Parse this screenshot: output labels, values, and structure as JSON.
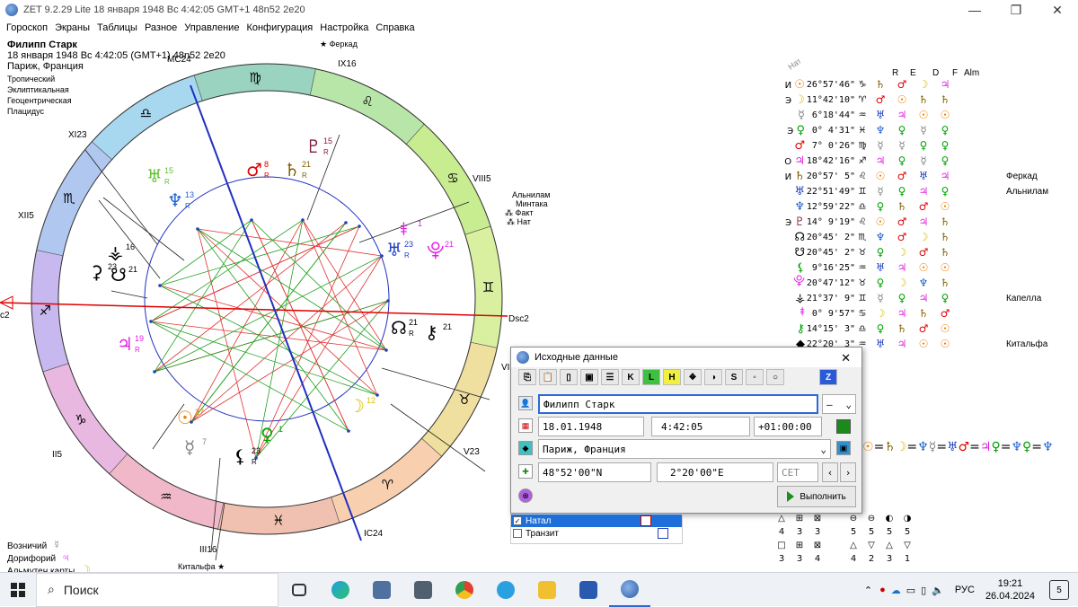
{
  "window": {
    "title": "ZET 9.2.29 Lite   18 января 1948  Вс   4:42:05 GMT+1 48n52  2e20",
    "minimize": "—",
    "maximize": "❐",
    "close": "✕"
  },
  "menu": [
    "Гороскоп",
    "Экраны",
    "Таблицы",
    "Разное",
    "Управление",
    "Конфигурация",
    "Настройка",
    "Справка"
  ],
  "info": {
    "name": "Филипп Старк",
    "datetime": "18 января 1948  Вс   4:42:05 (GMT+1) 48n52  2e20",
    "place": "Париж, Франция",
    "zodiac": "Тропический",
    "coords": "Эклиптикальная",
    "center": "Геоцентрическая",
    "houses": "Плацидус"
  },
  "rulers": [
    {
      "label": "Возничий",
      "glyph": "☿",
      "color": "#808080"
    },
    {
      "label": "Дорифорий",
      "glyph": "♃",
      "color": "#e020e0"
    },
    {
      "label": "Альмутен карты",
      "glyph": "☽",
      "color": "#d8c000"
    }
  ],
  "wheel": {
    "houses": {
      "asc": "c2",
      "dsc": "Dsc2",
      "mc": "MC24",
      "ic": "IC24",
      "h2": "II5",
      "h3": "III16",
      "h5": "V23",
      "h6": "VI5",
      "h8": "VIII5",
      "h9": "IX16",
      "h11": "XI23",
      "h12": "XII5"
    },
    "stars": {
      "ferkad": "Феркад",
      "alnilam": "Альнилам",
      "mintaka": "Минтака",
      "fakt": "Факт",
      "nat": "Нат",
      "kitalfa": "Китальфа"
    },
    "planets": [
      {
        "glyph": "☉",
        "deg": "27",
        "color": "#f08000"
      },
      {
        "glyph": "☽",
        "deg": "12",
        "color": "#d8c000"
      },
      {
        "glyph": "☿",
        "deg": "7",
        "color": "#808080"
      },
      {
        "glyph": "♀",
        "deg": "1",
        "color": "#00a000"
      },
      {
        "glyph": "♂",
        "deg": "8",
        "color": "#e00000"
      },
      {
        "glyph": "♃",
        "deg": "19",
        "color": "#e020e0"
      },
      {
        "glyph": "♄",
        "deg": "21",
        "color": "#806000"
      },
      {
        "glyph": "♅",
        "deg": "23",
        "color": "#2040c0"
      },
      {
        "glyph": "♆",
        "deg": "13",
        "color": "#2060d0"
      },
      {
        "glyph": "♇",
        "deg": "15",
        "color": "#802040"
      },
      {
        "glyph": "☊",
        "deg": "21",
        "color": "#000000"
      },
      {
        "glyph": "☋",
        "deg": "21",
        "color": "#000000"
      },
      {
        "glyph": "⚸",
        "deg": "23",
        "color": "#000000"
      },
      {
        "glyph": "⚷",
        "deg": "21",
        "color": "#000000"
      },
      {
        "glyph": "♅",
        "deg": "15",
        "color": "#60c030"
      },
      {
        "glyph": "⚶",
        "deg": "16",
        "color": "#000000"
      },
      {
        "glyph": "⚳",
        "deg": "23",
        "color": "#000000"
      },
      {
        "glyph": "⯓",
        "deg": "21",
        "color": "#e020e0"
      },
      {
        "glyph": "⯒",
        "deg": "1",
        "color": "#e020e0"
      }
    ],
    "retro": "R"
  },
  "table": {
    "header_label": "Нат",
    "cols": [
      "R",
      "E",
      "D",
      "F",
      "Alm"
    ],
    "rows": [
      {
        "pre": "И",
        "p": "☉",
        "pc": "#f08000",
        "deg": "26°57'46\"",
        "sg": "♑",
        "c": [
          "♄",
          "♂",
          "☽",
          "♃"
        ],
        "cc": [
          "#806000",
          "#e00000",
          "#d8c000",
          "#e020e0"
        ],
        "star": ""
      },
      {
        "pre": "Э",
        "p": "☽",
        "pc": "#d8c000",
        "deg": "11°42'10\"",
        "sg": "♈",
        "c": [
          "♂",
          "☉",
          "♄",
          "♄"
        ],
        "cc": [
          "#e00000",
          "#f08000",
          "#806000",
          "#806000"
        ],
        "star": ""
      },
      {
        "pre": "",
        "p": "☿",
        "pc": "#808080",
        "deg": "6°18'44\"",
        "sg": "♒",
        "c": [
          "♅",
          "♃",
          "☉",
          "☉"
        ],
        "cc": [
          "#2040c0",
          "#e020e0",
          "#f08000",
          "#f08000"
        ],
        "star": ""
      },
      {
        "pre": "Э",
        "p": "♀",
        "pc": "#00a000",
        "deg": "0° 4'31\"",
        "sg": "♓",
        "c": [
          "♆",
          "♀",
          "☿",
          "♀"
        ],
        "cc": [
          "#2060d0",
          "#00a000",
          "#808080",
          "#00a000"
        ],
        "star": ""
      },
      {
        "pre": "",
        "p": "♂",
        "pc": "#e00000",
        "deg": "7° 0'26\"",
        "sg": "♍",
        "c": [
          "☿",
          "☿",
          "♀",
          "♀"
        ],
        "cc": [
          "#808080",
          "#808080",
          "#00a000",
          "#00a000"
        ],
        "star": ""
      },
      {
        "pre": "О",
        "p": "♃",
        "pc": "#e020e0",
        "deg": "18°42'16\"",
        "sg": "♐",
        "c": [
          "♃",
          "♀",
          "☿",
          "♀"
        ],
        "cc": [
          "#e020e0",
          "#00a000",
          "#808080",
          "#00a000"
        ],
        "star": ""
      },
      {
        "pre": "И",
        "p": "♄",
        "pc": "#806000",
        "deg": "20°57' 5\"",
        "sg": "♌",
        "c": [
          "☉",
          "♂",
          "♅",
          "♃"
        ],
        "cc": [
          "#f08000",
          "#e00000",
          "#2040c0",
          "#e020e0"
        ],
        "star": "Феркад"
      },
      {
        "pre": "",
        "p": "♅",
        "pc": "#2040c0",
        "deg": "22°51'49\"",
        "sg": "♊",
        "c": [
          "☿",
          "♀",
          "♃",
          "♀"
        ],
        "cc": [
          "#808080",
          "#00a000",
          "#e020e0",
          "#00a000"
        ],
        "star": "Альнилам"
      },
      {
        "pre": "",
        "p": "♆",
        "pc": "#2060d0",
        "deg": "12°59'22\"",
        "sg": "♎",
        "c": [
          "♀",
          "♄",
          "♂",
          "☉"
        ],
        "cc": [
          "#00a000",
          "#806000",
          "#e00000",
          "#f08000"
        ],
        "star": ""
      },
      {
        "pre": "Э",
        "p": "♇",
        "pc": "#802040",
        "deg": "14° 9'19\"",
        "sg": "♌",
        "c": [
          "☉",
          "♂",
          "♃",
          "♄"
        ],
        "cc": [
          "#f08000",
          "#e00000",
          "#e020e0",
          "#806000"
        ],
        "star": ""
      },
      {
        "pre": "",
        "p": "☊",
        "pc": "#000000",
        "deg": "20°45' 2\"",
        "sg": "♏",
        "c": [
          "♆",
          "♂",
          "☽",
          "♄"
        ],
        "cc": [
          "#2060d0",
          "#e00000",
          "#d8c000",
          "#806000"
        ],
        "star": ""
      },
      {
        "pre": "",
        "p": "☋",
        "pc": "#000000",
        "deg": "20°45' 2\"",
        "sg": "♉",
        "c": [
          "♀",
          "☽",
          "♂",
          "♄"
        ],
        "cc": [
          "#00a000",
          "#d8c000",
          "#e00000",
          "#806000"
        ],
        "star": ""
      },
      {
        "pre": "",
        "p": "⚸",
        "pc": "#00a000",
        "deg": "9°16'25\"",
        "sg": "♒",
        "c": [
          "♅",
          "♃",
          "☉",
          "☉"
        ],
        "cc": [
          "#2040c0",
          "#e020e0",
          "#f08000",
          "#f08000"
        ],
        "star": ""
      },
      {
        "pre": "",
        "p": "⯓",
        "pc": "#e020e0",
        "deg": "20°47'12\"",
        "sg": "♉",
        "c": [
          "♀",
          "☽",
          "♆",
          "♄"
        ],
        "cc": [
          "#00a000",
          "#d8c000",
          "#2060d0",
          "#806000"
        ],
        "star": ""
      },
      {
        "pre": "",
        "p": "⚶",
        "pc": "#000000",
        "deg": "21°37' 9\"",
        "sg": "♊",
        "c": [
          "☿",
          "♀",
          "♃",
          "♀"
        ],
        "cc": [
          "#808080",
          "#00a000",
          "#e020e0",
          "#00a000"
        ],
        "star": "Капелла"
      },
      {
        "pre": "",
        "p": "⯒",
        "pc": "#e020e0",
        "deg": "0° 9'57\"",
        "sg": "♋",
        "c": [
          "☽",
          "♃",
          "♄",
          "♂"
        ],
        "cc": [
          "#d8c000",
          "#e020e0",
          "#806000",
          "#e00000"
        ],
        "star": ""
      },
      {
        "pre": "",
        "p": "⚷",
        "pc": "#00a000",
        "deg": "14°15' 3\"",
        "sg": "♎",
        "c": [
          "♀",
          "♄",
          "♂",
          "☉"
        ],
        "cc": [
          "#00a000",
          "#806000",
          "#e00000",
          "#f08000"
        ],
        "star": ""
      },
      {
        "pre": "",
        "p": "◆",
        "pc": "#000000",
        "deg": "22°20' 3\"",
        "sg": "♒",
        "c": [
          "♅",
          "♃",
          "☉",
          "☉"
        ],
        "cc": [
          "#2040c0",
          "#e020e0",
          "#f08000",
          "#f08000"
        ],
        "star": "Китальфа"
      }
    ]
  },
  "dialog": {
    "title": "Исходные данные",
    "close": "✕",
    "name": "Филипп Старк",
    "gender": "—",
    "date": "18.01.1948",
    "time": "4:42:05",
    "tz": "+01:00:00",
    "place": "Париж, Франция",
    "lat": "48°52'00\"N",
    "lon": "2°20'00\"E",
    "zone": "CET",
    "run": "Выполнить"
  },
  "charts_list": [
    {
      "label": "Натал",
      "checked": true
    },
    {
      "label": "Транзит",
      "checked": false
    }
  ],
  "aspect_line": "☉=♄☽=♆☿=♅♂=♃♀=♆♀=♆",
  "elements_grid": {
    "row1_syms": [
      "△",
      "⊞",
      "⊠",
      "⊖",
      "⊖",
      "◐",
      "◑"
    ],
    "row1_vals": [
      "4",
      "3",
      "3",
      "5",
      "5",
      "5",
      "5"
    ],
    "row2_syms": [
      "□",
      "⊞",
      "⊠",
      "△",
      "▽",
      "△",
      "▽"
    ],
    "row2_vals": [
      "3",
      "3",
      "4",
      "4",
      "2",
      "3",
      "1"
    ]
  },
  "taskbar": {
    "search": "Поиск",
    "lang": "РУС",
    "time": "19:21",
    "date": "26.04.2024",
    "notif": "5"
  }
}
